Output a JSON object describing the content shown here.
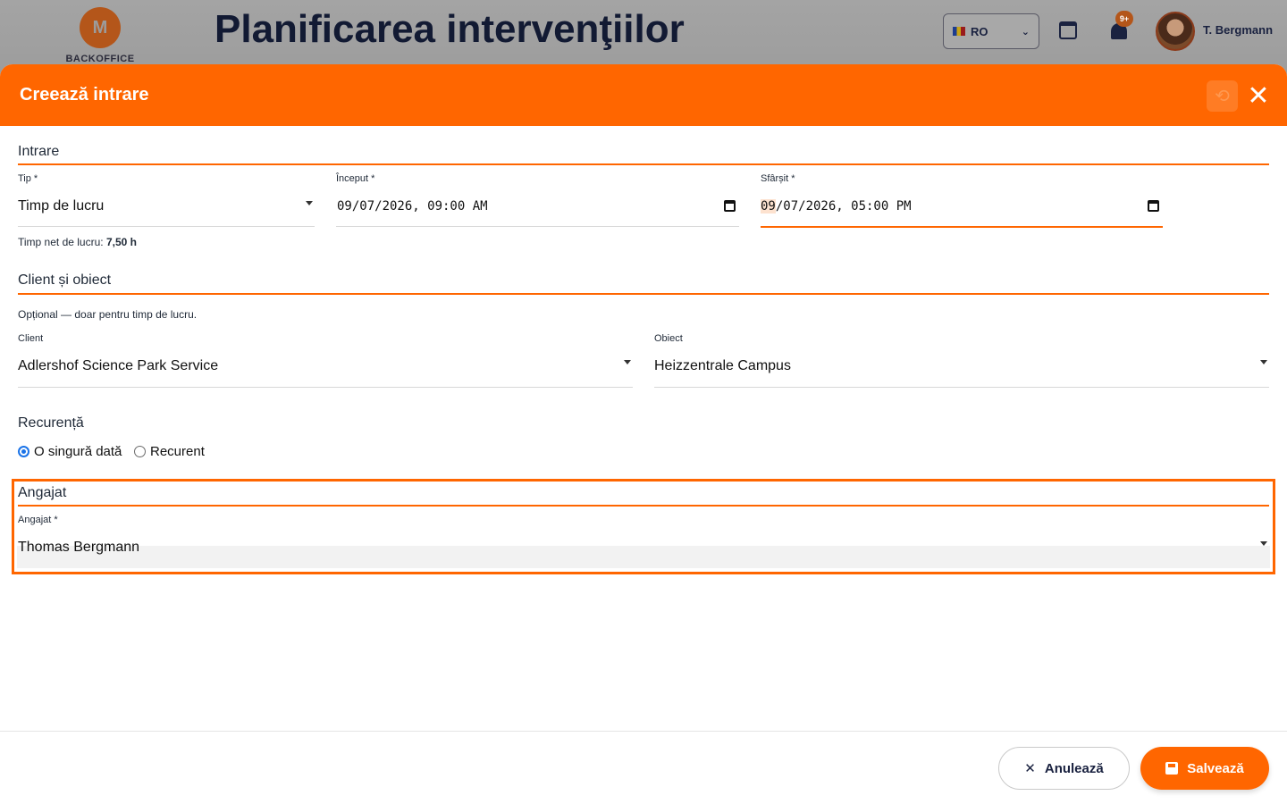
{
  "app": {
    "logo_text": "BACKOFFICE",
    "logo_letter": "M",
    "page_title": "Planificarea intervenţiilor",
    "language": "RO",
    "notifications_badge": "9+",
    "user_name": "T. Bergmann"
  },
  "modal": {
    "title": "Creează intrare",
    "sections": {
      "entry": {
        "title": "Intrare",
        "type_label": "Tip *",
        "type_value": "Timp de lucru",
        "start_label": "Început *",
        "start_value": "09/07/2026, 09:00 AM",
        "end_label": "Sfârșit *",
        "end_value_day": "09",
        "end_value_rest": "/07/2026, 05:00 PM",
        "net_time_label": "Timp net de lucru:",
        "net_time_value": "7,50 h"
      },
      "client": {
        "title": "Client și obiect",
        "hint": "Opțional — doar pentru timp de lucru.",
        "client_label": "Client",
        "client_value": "Adlershof Science Park Service",
        "object_label": "Obiect",
        "object_value": "Heizzentrale Campus"
      },
      "recurrence": {
        "title": "Recurență",
        "options": [
          "O singură dată",
          "Recurent"
        ],
        "selected": "O singură dată"
      },
      "employee": {
        "title": "Angajat",
        "employee_label": "Angajat *",
        "employee_value": "Thomas Bergmann"
      }
    },
    "footer": {
      "cancel_label": "Anulează",
      "save_label": "Salvează"
    }
  },
  "colors": {
    "accent": "#ff6600",
    "header_bg": "#ff6600",
    "radio_selected": "#1a73e8"
  }
}
